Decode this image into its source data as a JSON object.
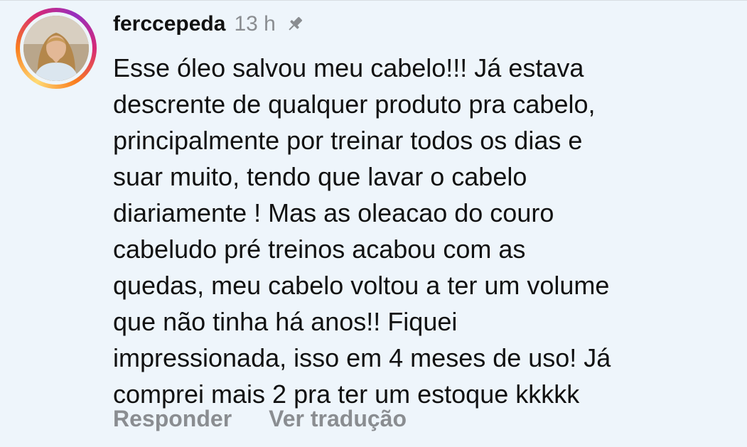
{
  "comment": {
    "username": "ferccepeda",
    "time": "13 h",
    "text_lines": [
      "Esse óleo salvou meu cabelo!!! Já estava",
      "descrente de qualquer produto pra cabelo,",
      "principalmente por treinar todos os dias e",
      "suar muito, tendo que lavar o cabelo",
      "diariamente ! Mas as oleacao do couro",
      "cabeludo pré treinos acabou com as",
      "quedas, meu cabelo voltou a ter um volume",
      "que não tinha há anos!! Fiquei",
      "impressionada, isso em 4 meses de uso! Já",
      "comprei mais 2 pra ter um estoque kkkkk"
    ],
    "pin_icon": "pin-icon",
    "actions": {
      "reply": "Responder",
      "translate": "Ver tradução"
    }
  },
  "colors": {
    "background": "#eef5fb",
    "text": "#111111",
    "secondary": "#8a8d91"
  }
}
